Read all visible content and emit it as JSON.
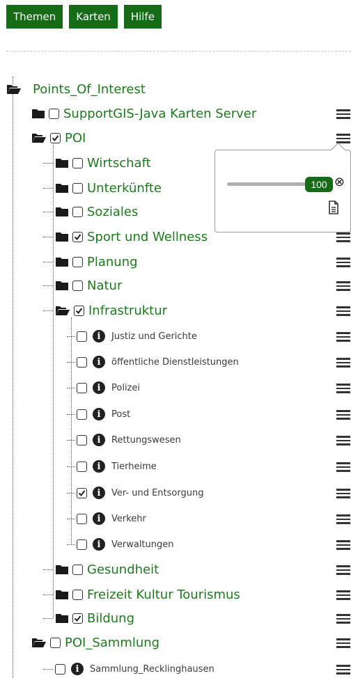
{
  "header": {
    "buttons": [
      "Themen",
      "Karten",
      "Hilfe"
    ]
  },
  "colors": {
    "accent": "#166b16",
    "label": "#1e7a1e"
  },
  "tree": {
    "root": {
      "label": "Points_Of_Interest",
      "icon": "folder-open-icon"
    },
    "support": {
      "label": "SupportGIS-Java Karten Server",
      "checked": false
    },
    "poi": {
      "label": "POI",
      "checked": true,
      "children": [
        {
          "label": "Wirtschaft",
          "checked": false
        },
        {
          "label": "Unterkünfte",
          "checked": false
        },
        {
          "label": "Soziales",
          "checked": false
        },
        {
          "label": "Sport und Wellness",
          "checked": true
        },
        {
          "label": "Planung",
          "checked": false
        },
        {
          "label": "Natur",
          "checked": false
        },
        {
          "label": "Infrastruktur",
          "checked": true
        }
      ]
    },
    "infrastruktur_children": [
      {
        "label": "Justiz und Gerichte",
        "checked": false
      },
      {
        "label": "öffentliche Dienstleistungen",
        "checked": false
      },
      {
        "label": "Polizei",
        "checked": false
      },
      {
        "label": "Post",
        "checked": false
      },
      {
        "label": "Rettungswesen",
        "checked": false
      },
      {
        "label": "Tierheime",
        "checked": false
      },
      {
        "label": "Ver- und Entsorgung",
        "checked": true
      },
      {
        "label": "Verkehr",
        "checked": false
      },
      {
        "label": "Verwaltungen",
        "checked": false
      }
    ],
    "poi_after": [
      {
        "label": "Gesundheit",
        "checked": false
      },
      {
        "label": "Freizeit Kultur Tourismus",
        "checked": false
      },
      {
        "label": "Bildung",
        "checked": true
      }
    ],
    "sammlung": {
      "label": "POI_Sammlung",
      "checked": false,
      "children": [
        {
          "label": "Sammlung_Recklinghausen",
          "checked": false
        }
      ]
    }
  },
  "popup": {
    "opacity_value": "100",
    "icons": [
      "close-circle-icon",
      "document-icon"
    ]
  }
}
